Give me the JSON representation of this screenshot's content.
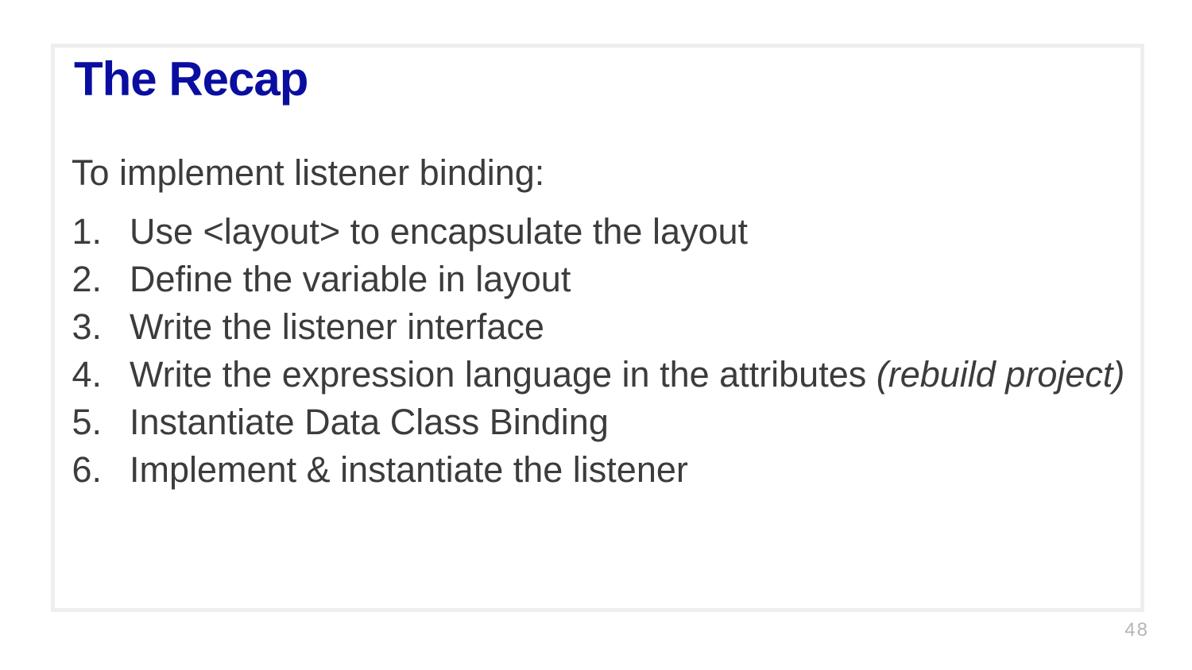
{
  "slide": {
    "title": "The Recap",
    "intro": "To implement listener binding:",
    "steps": [
      {
        "number": "1.",
        "text": "Use <layout> to encapsulate the layout",
        "note": ""
      },
      {
        "number": "2.",
        "text": "Define the variable in layout",
        "note": ""
      },
      {
        "number": "3.",
        "text": "Write the listener interface",
        "note": ""
      },
      {
        "number": "4.",
        "text": "Write the expression language in the attributes ",
        "note": "(rebuild project)"
      },
      {
        "number": "5.",
        "text": "Instantiate Data Class Binding",
        "note": ""
      },
      {
        "number": "6.",
        "text": "Implement & instantiate the listener",
        "note": ""
      }
    ],
    "page_number": "48"
  },
  "colors": {
    "title": "#0a0ea0",
    "body_text": "#3c3c3c",
    "frame_border": "#eeeeee",
    "page_number": "#b5b5b5"
  }
}
